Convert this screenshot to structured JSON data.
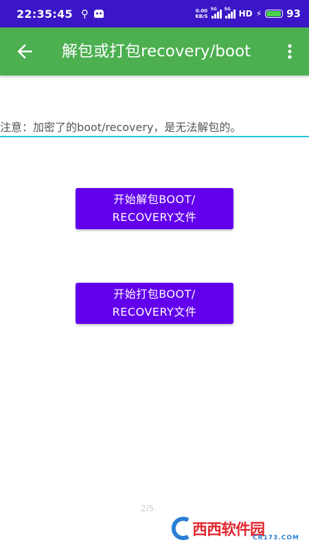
{
  "status_bar": {
    "time": "22:35:45",
    "usb_icon": "usb-icon",
    "android_icon": "android-debug-icon",
    "net_speed_value": "0.00",
    "net_speed_unit": "KB/S",
    "network_1": "5G",
    "network_2": "5G",
    "hd_label": "HD",
    "battery_level": "93",
    "battery_fraction": 0.93,
    "battery_color": "#48d34a"
  },
  "app_bar": {
    "title": "解包或打包recovery/boot",
    "back_icon": "back-arrow-icon",
    "menu_icon": "more-vert-icon",
    "color": "#4caf50"
  },
  "content": {
    "notice": "注意：加密了的boot/recovery，是无法解包的。",
    "unpack_button": "开始解包BOOT/\nRECOVERY文件",
    "pack_button": "开始打包BOOT/\nRECOVERY文件",
    "button_color": "#6200ee",
    "underline_color": "#26c6da"
  },
  "page_indicator": "2/5",
  "watermark": {
    "logo_text": "西西软件园",
    "domain": "CR173.COM"
  }
}
